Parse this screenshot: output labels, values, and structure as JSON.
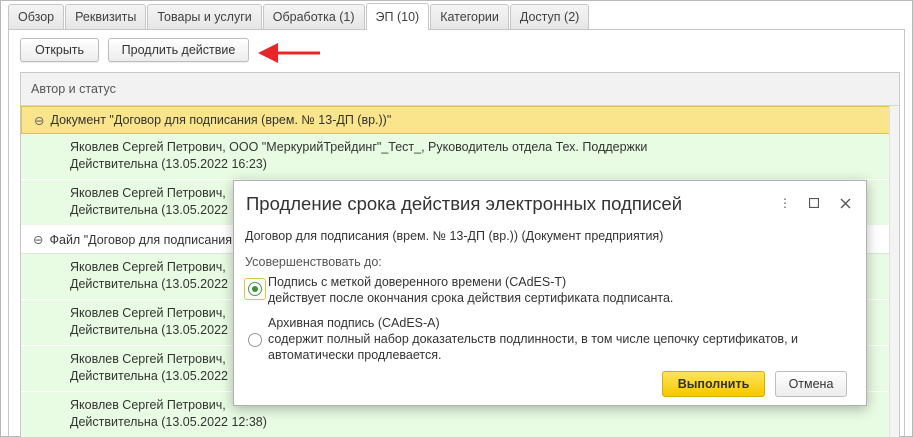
{
  "tabs": [
    {
      "label": "Обзор",
      "active": false
    },
    {
      "label": "Реквизиты",
      "active": false
    },
    {
      "label": "Товары и услуги",
      "active": false
    },
    {
      "label": "Обработка (1)",
      "active": false
    },
    {
      "label": "ЭП (10)",
      "active": true
    },
    {
      "label": "Категории",
      "active": false
    },
    {
      "label": "Доступ (2)",
      "active": false
    }
  ],
  "toolbar": {
    "open_label": "Открыть",
    "extend_label": "Продлить действие"
  },
  "grid": {
    "column_header": "Автор и статус",
    "document_group": "Документ \"Договор для подписания (врем. № 13-ДП (вр.))\"",
    "file_group": "Файл \"Договор для подписания",
    "group_toggle": "⊖",
    "rows_doc": [
      {
        "author": "Яковлев Сергей Петрович, ООО \"МеркурийТрейдинг\"_Тест_, Руководитель отдела Тех. Поддержки",
        "status": "Действительна (13.05.2022 16:23)"
      },
      {
        "author": "Яковлев Сергей Петрович,",
        "status": "Действительна (13.05.2022"
      }
    ],
    "rows_file": [
      {
        "author": "Яковлев Сергей Петрович,",
        "status": "Действительна (13.05.2022"
      },
      {
        "author": "Яковлев Сергей Петрович,",
        "status": "Действительна (13.05.2022"
      },
      {
        "author": "Яковлев Сергей Петрович,",
        "status": "Действительна (13.05.2022"
      },
      {
        "author": "Яковлев Сергей Петрович,",
        "status": "Действительна (13.05.2022 12:38)"
      }
    ]
  },
  "dialog": {
    "title": "Продление срока действия электронных подписей",
    "document": "Договор для подписания (врем. № 13-ДП (вр.)) (Документ предприятия)",
    "improve_label": "Усовершенствовать до:",
    "option1_title": "Подпись с меткой доверенного времени (CAdES-T)",
    "option1_desc": "действует после окончания срока действия сертификата подписанта.",
    "option2_title": "Архивная подпись (CAdES-A)",
    "option2_desc1": "содержит полный набор доказательств подлинности, в том числе цепочку сертификатов, и",
    "option2_desc2": "автоматически продлевается.",
    "selected_option": 1,
    "run_label": "Выполнить",
    "cancel_label": "Отмена",
    "more_glyph": "⋮",
    "maximize_glyph": "☐",
    "close_glyph": "✕"
  },
  "colors": {
    "annotation_arrow": "#e8262a",
    "primary_button": "#f6c800",
    "selected_group": "#fbe58c",
    "signature_row": "#e8fbe3"
  }
}
